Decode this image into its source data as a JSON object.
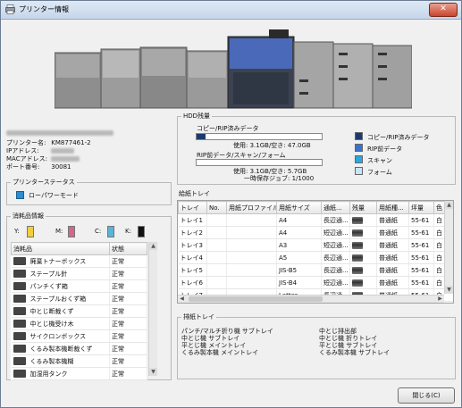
{
  "window": {
    "title": "プリンター情報",
    "close_glyph": "✕"
  },
  "device": {
    "rows": [
      {
        "label": "プリンター名:",
        "value": "KM877461-2",
        "blurred": true
      },
      {
        "label": "IPアドレス:",
        "value": "",
        "blurred": true
      },
      {
        "label": "MACアドレス:",
        "value": "",
        "blurred": true
      },
      {
        "label": "ポート番号:",
        "value": "30081",
        "blurred": false
      }
    ]
  },
  "status": {
    "title": "プリンターステータス",
    "mode": "ローパワーモード",
    "color": "#2e8ccf"
  },
  "consumables": {
    "title": "消耗品情報",
    "toners": [
      {
        "label": "Y:",
        "color": "#f2cf3a"
      },
      {
        "label": "M:",
        "color": "#d2668e"
      },
      {
        "label": "C:",
        "color": "#5bb3d7"
      },
      {
        "label": "K:",
        "color": "#111111"
      }
    ],
    "headers": [
      "消耗品",
      "状態"
    ],
    "items": [
      {
        "name": "廃棄トナーボックス",
        "state": "正常"
      },
      {
        "name": "ステープル針",
        "state": "正常"
      },
      {
        "name": "パンチくず箱",
        "state": "正常"
      },
      {
        "name": "ステープルおくず箱",
        "state": "正常"
      },
      {
        "name": "中とじ断裁くず",
        "state": "正常"
      },
      {
        "name": "中とじ機受け木",
        "state": "正常"
      },
      {
        "name": "サイクロンボックス",
        "state": "正常"
      },
      {
        "name": "くるみ製本機断裁くず",
        "state": "正常"
      },
      {
        "name": "くるみ製本機糊",
        "state": "正常"
      },
      {
        "name": "加湿用タンク",
        "state": "正常"
      }
    ]
  },
  "hdd": {
    "title": "HDD残量",
    "sections": [
      {
        "label": "コピー/RIP済みデータ",
        "usage": "使用: 3.1GB/空き: 47.0GB",
        "used_fraction": 0.07,
        "extra": ""
      },
      {
        "label": "RIP前データ/スキャン/フォーム",
        "usage": "使用: 3.1GB/空き: 5.7GB",
        "used_fraction": 0.0,
        "extra": "一時保存ジョブ: 1/1000"
      }
    ],
    "legend": [
      {
        "label": "コピー/RIP済みデータ",
        "color": "#1c3a72"
      },
      {
        "label": "RIP前データ",
        "color": "#3d6fd1"
      },
      {
        "label": "スキャン",
        "color": "#2aa8dc"
      },
      {
        "label": "フォーム",
        "color": "#c9e4f7"
      }
    ]
  },
  "trays": {
    "title": "給紙トレイ",
    "headers": [
      "トレイ",
      "No.",
      "用紙プロファイル",
      "用紙サイズ",
      "通紙...",
      "残量",
      "用紙種...",
      "坪量",
      "色"
    ],
    "rows": [
      {
        "tray": "トレイ1",
        "no": "",
        "profile": "",
        "size": "A4",
        "feed": "長辺通...",
        "type": "普通紙",
        "weight": "55-61",
        "color": "白"
      },
      {
        "tray": "トレイ2",
        "no": "",
        "profile": "",
        "size": "A4",
        "feed": "短辺通...",
        "type": "普通紙",
        "weight": "55-61",
        "color": "白"
      },
      {
        "tray": "トレイ3",
        "no": "",
        "profile": "",
        "size": "A3",
        "feed": "短辺通...",
        "type": "普通紙",
        "weight": "55-61",
        "color": "白"
      },
      {
        "tray": "トレイ4",
        "no": "",
        "profile": "",
        "size": "A5",
        "feed": "長辺通...",
        "type": "普通紙",
        "weight": "55-61",
        "color": "白"
      },
      {
        "tray": "トレイ5",
        "no": "",
        "profile": "",
        "size": "JIS-B5",
        "feed": "長辺通...",
        "type": "普通紙",
        "weight": "55-61",
        "color": "白"
      },
      {
        "tray": "トレイ6",
        "no": "",
        "profile": "",
        "size": "JIS-B4",
        "feed": "短辺通...",
        "type": "普通紙",
        "weight": "55-61",
        "color": "白"
      },
      {
        "tray": "トレイ7",
        "no": "",
        "profile": "",
        "size": "Letter",
        "feed": "長辺通...",
        "type": "普通紙",
        "weight": "55-61",
        "color": "白"
      }
    ]
  },
  "output": {
    "title": "排紙トレイ",
    "left": [
      "パンチ/マルチ折り機 サブトレイ",
      "中とじ機 サブトレイ",
      "平とじ機 メイントレイ",
      "くるみ製本機 メイントレイ"
    ],
    "right": [
      "中とじ排出部",
      "中とじ機 折りトレイ",
      "平とじ機 サブトレイ",
      "くるみ製本機 サブトレイ"
    ]
  },
  "footer": {
    "close_button": "閉じる(C)"
  }
}
